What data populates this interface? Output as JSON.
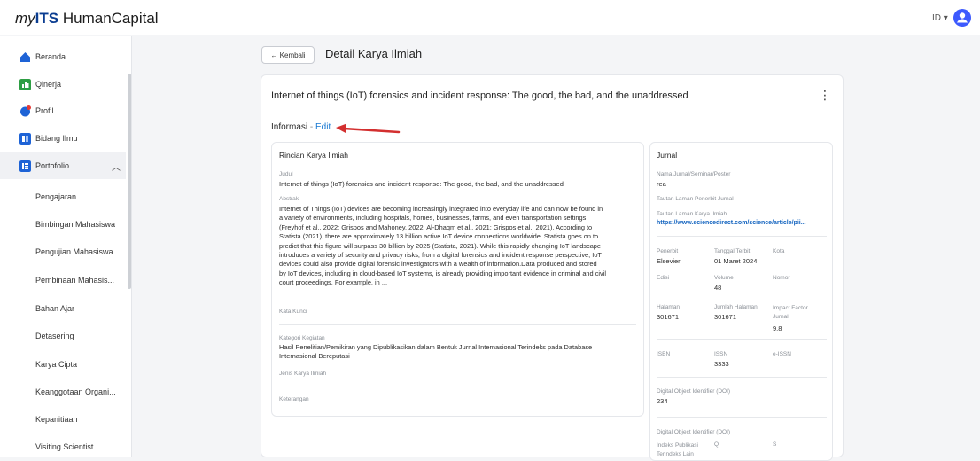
{
  "app": {
    "logo_prefix": "my",
    "logo_brand": "ITS",
    "logo_suffix": " HumanCapital",
    "lang": "ID ▾"
  },
  "sidebar": {
    "items": [
      {
        "label": "Beranda",
        "icon": "home-icon"
      },
      {
        "label": "Qinerja",
        "icon": "chart-icon"
      },
      {
        "label": "Profil",
        "icon": "profile-icon"
      },
      {
        "label": "Bidang Ilmu",
        "icon": "book-icon"
      },
      {
        "label": "Portofolio",
        "icon": "portfolio-icon"
      }
    ],
    "sub_items": [
      "Pengajaran",
      "Bimbingan Mahasiswa",
      "Pengujian Mahasiswa",
      "Pembinaan Mahasis...",
      "Bahan Ajar",
      "Detasering",
      "Karya Cipta",
      "Keanggotaan Organi...",
      "Kepanitiaan",
      "Visiting Scientist"
    ]
  },
  "header": {
    "back_label": "← Kembali",
    "title": "Detail Karya Ilmiah"
  },
  "doc": {
    "title": "Internet of things (IoT) forensics and incident response: The good, the bad, and the unaddressed",
    "info_label": "Informasi",
    "sep": " - ",
    "edit_label": "Edit"
  },
  "rincian": {
    "heading": "Rincian Karya Ilmiah",
    "judul_label": "Judul",
    "judul": "Internet of things (IoT) forensics and incident response: The good, the bad, and the unaddressed",
    "abstrak_label": "Abstrak",
    "abstrak": "Internet of Things (IoT) devices are becoming increasingly integrated into everyday life and can now be found in\na variety of environments, including hospitals, homes, businesses, farms, and even transportation settings\n(Freyhof et al., 2022; Grispos and Mahoney, 2022; Al-Dhaqm et al., 2021; Grispos et al., 2021). According to\nStatista (2021), there are approximately 13 billion active IoT device connections worldwide. Statista goes on to\npredict that this figure will surpass 30 billion by 2025 (Statista, 2021). While this rapidly changing IoT landscape\nintroduces a variety of security and privacy risks, from a digital forensics and incident response perspective, IoT\ndevices could also provide digital forensic investigators with a wealth of information.Data produced and stored\nby IoT devices, including in cloud-based IoT systems, is already providing important evidence in criminal and civil\ncourt proceedings. For example, in ...",
    "kata_kunci_label": "Kata Kunci",
    "kategori_label": "Kategori Kegiatan",
    "kategori": "Hasil Penelitian/Pemikiran yang Dipublikasikan dalam Bentuk Jurnal Internasional Terindeks pada Database\nInternasional Bereputasi",
    "jenis_label": "Jenis Karya Ilmiah",
    "keterangan_label": "Keterangan"
  },
  "jurnal": {
    "heading": "Jurnal",
    "nama_label": "Nama Jurnal/Seminar/Poster",
    "nama": "rea",
    "tautan_penerbit_label": "Tautan Laman Penerbit Jurnal",
    "tautan_karya_label": "Tautan Laman Karya Ilmiah",
    "tautan_karya": "https://www.sciencedirect.com/science/article/pii...",
    "penerbit_label": "Penerbit",
    "penerbit": "Elsevier",
    "tanggal_label": "Tanggal Terbit",
    "tanggal": "01 Maret 2024",
    "kota_label": "Kota",
    "edisi_label": "Edisi",
    "volume_label": "Volume",
    "volume": "48",
    "nomor_label": "Nomor",
    "halaman_label": "Halaman",
    "halaman": "301671",
    "jumlah_label": "Jumlah Halaman",
    "jumlah": "301671",
    "impact_label": "Impact Factor\nJurnal",
    "impact": "9.8",
    "isbn_label": "ISBN",
    "issn_label": "ISSN",
    "issn": "3333",
    "eissn_label": "e-ISSN",
    "doi_label": "Digital Object Identifier (DOI)",
    "doi": "234",
    "doi2_label": "Digital Object Identifier (DOI)",
    "indeks_label": "Indeks Publikasi\nTerindeks Lain",
    "q_label": "Q",
    "s_label": "S"
  },
  "colors": {
    "accent": "#1677d2",
    "brand": "#0b3d91",
    "arrow": "#d32f2f"
  }
}
